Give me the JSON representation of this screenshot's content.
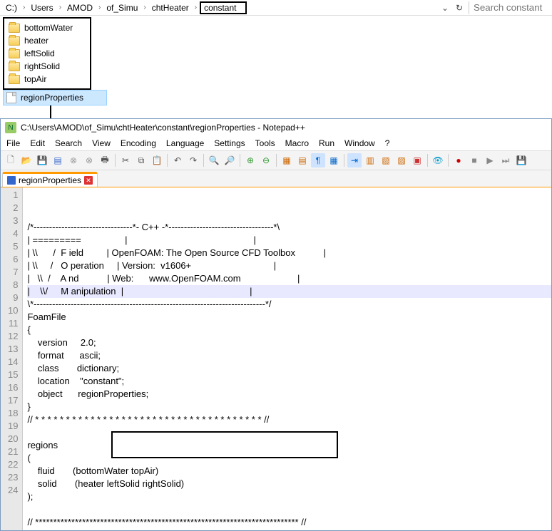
{
  "explorer": {
    "breadcrumb": [
      "C:)",
      "Users",
      "AMOD",
      "of_Simu",
      "chtHeater",
      "constant"
    ],
    "search_placeholder": "Search constant",
    "folders": [
      "bottomWater",
      "heater",
      "leftSolid",
      "rightSolid",
      "topAir"
    ],
    "selected_file": "regionProperties"
  },
  "npp": {
    "title": "C:\\Users\\AMOD\\of_Simu\\chtHeater\\constant\\regionProperties - Notepad++",
    "menu": [
      "File",
      "Edit",
      "Search",
      "View",
      "Encoding",
      "Language",
      "Settings",
      "Tools",
      "Macro",
      "Run",
      "Window",
      "?"
    ],
    "tab": "regionProperties",
    "lines": [
      "/*--------------------------------*- C++ -*----------------------------------*\\",
      "| =========                 |                                                 |",
      "| \\\\      /  F ield         | OpenFOAM: The Open Source CFD Toolbox           |",
      "| \\\\     /   O peration     | Version:  v1606+                                |",
      "|   \\\\  /    A nd           | Web:      www.OpenFOAM.com                      |",
      "|    \\\\/     M anipulation  |                                                 |",
      "\\*---------------------------------------------------------------------------*/",
      "FoamFile",
      "{",
      "    version     2.0;",
      "    format      ascii;",
      "    class       dictionary;",
      "    location    \"constant\";",
      "    object      regionProperties;",
      "}",
      "// * * * * * * * * * * * * * * * * * * * * * * * * * * * * * * * * * * * * * //",
      "",
      "regions",
      "(",
      "    fluid       (bottomWater topAir)",
      "    solid       (heater leftSolid rightSolid)",
      ");",
      "",
      "// ************************************************************************* //"
    ]
  }
}
